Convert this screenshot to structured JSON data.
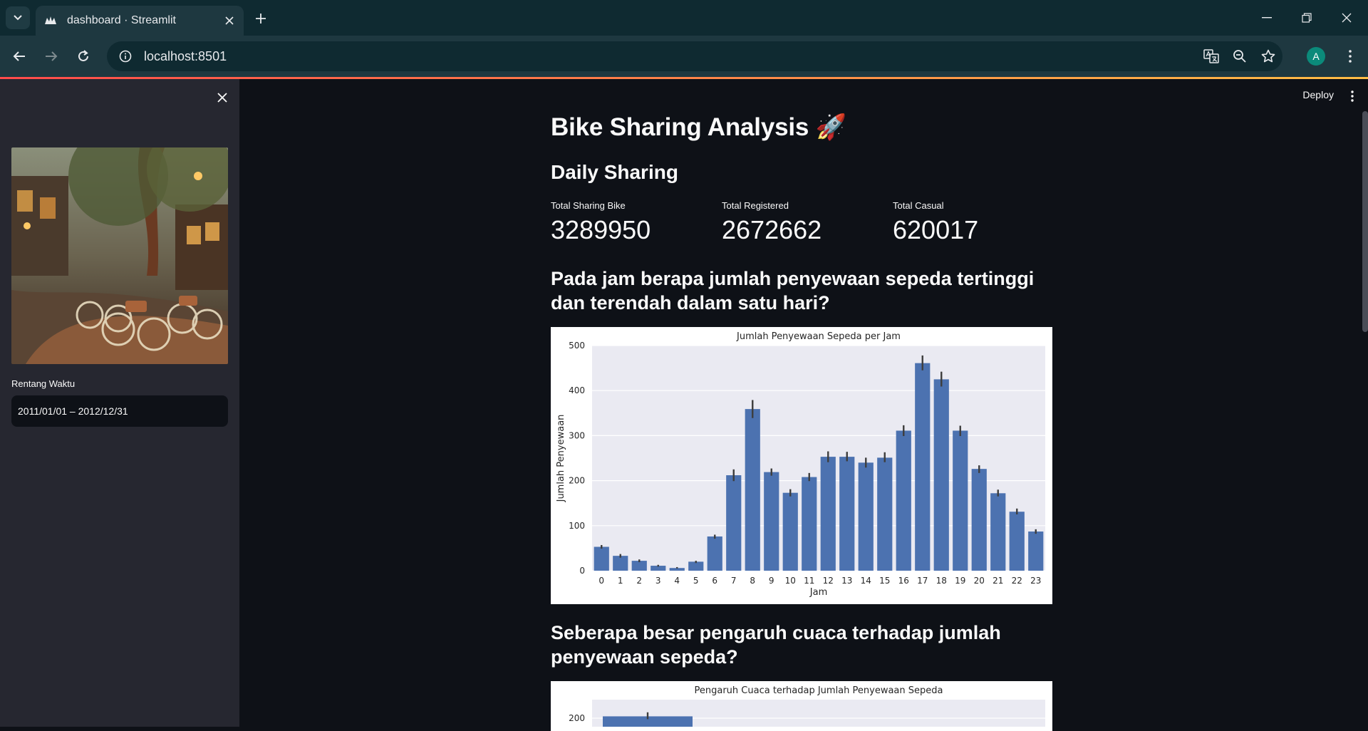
{
  "browser": {
    "tab_title": "dashboard · Streamlit",
    "url": "localhost:8501"
  },
  "profile": {
    "initial": "A",
    "color": "#0b8a7a"
  },
  "header": {
    "deploy_label": "Deploy"
  },
  "sidebar": {
    "date_label": "Rentang Waktu",
    "date_value": "2011/01/01 – 2012/12/31"
  },
  "main": {
    "title": "Bike Sharing Analysis 🚀",
    "subheader": "Daily Sharing",
    "metrics": [
      {
        "label": "Total Sharing Bike",
        "value": "3289950"
      },
      {
        "label": "Total Registered",
        "value": "2672662"
      },
      {
        "label": "Total Casual",
        "value": "620017"
      }
    ],
    "question1": "Pada jam berapa jumlah penyewaan sepeda tertinggi dan terendah dalam satu hari?",
    "question2": "Seberapa besar pengaruh cuaca terhadap jumlah penyewaan sepeda?"
  },
  "chart_data": [
    {
      "type": "bar",
      "title": "Jumlah Penyewaan Sepeda per Jam",
      "xlabel": "Jam",
      "ylabel": "Jumlah Penyewaan",
      "ylim": [
        0,
        500
      ],
      "yticks": [
        0,
        100,
        200,
        300,
        400,
        500
      ],
      "grid": true,
      "color": "#4c72b0",
      "categories": [
        "0",
        "1",
        "2",
        "3",
        "4",
        "5",
        "6",
        "7",
        "8",
        "9",
        "10",
        "11",
        "12",
        "13",
        "14",
        "15",
        "16",
        "17",
        "18",
        "19",
        "20",
        "21",
        "22",
        "23"
      ],
      "values": [
        53,
        33,
        22,
        11,
        6,
        20,
        76,
        212,
        359,
        219,
        173,
        208,
        253,
        253,
        240,
        251,
        311,
        461,
        425,
        311,
        226,
        172,
        131,
        87
      ],
      "error_low": [
        49,
        29,
        19,
        9,
        5,
        17,
        71,
        199,
        339,
        211,
        165,
        199,
        241,
        243,
        229,
        241,
        299,
        445,
        409,
        299,
        217,
        165,
        125,
        82
      ],
      "error_high": [
        57,
        37,
        25,
        13,
        8,
        22,
        80,
        225,
        379,
        227,
        181,
        217,
        265,
        264,
        251,
        263,
        323,
        478,
        442,
        322,
        234,
        180,
        138,
        92
      ]
    },
    {
      "type": "bar",
      "title": "Pengaruh Cuaca terhadap Jumlah Penyewaan Sepeda",
      "yticks_visible": [
        200
      ],
      "color": "#4c72b0",
      "values": [
        205
      ],
      "error_high": [
        216
      ]
    }
  ]
}
